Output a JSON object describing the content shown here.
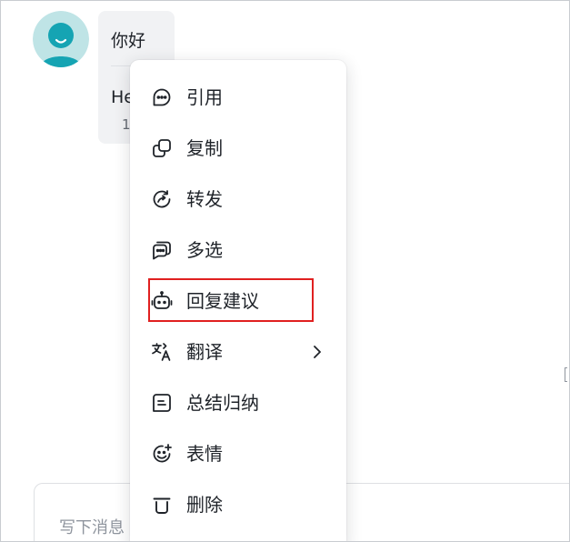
{
  "message": {
    "text": "你好",
    "translation_prefix": "He",
    "meta_prefix": "1"
  },
  "composer": {
    "placeholder": "写下消息"
  },
  "menu": {
    "items": [
      {
        "label": "引用",
        "icon": "quote-icon"
      },
      {
        "label": "复制",
        "icon": "copy-icon"
      },
      {
        "label": "转发",
        "icon": "forward-icon"
      },
      {
        "label": "多选",
        "icon": "multi-select-icon"
      },
      {
        "label": "回复建议",
        "icon": "robot-icon",
        "highlighted": true
      },
      {
        "label": "翻译",
        "icon": "translate-icon",
        "has_submenu": true
      },
      {
        "label": "总结归纳",
        "icon": "summary-icon"
      },
      {
        "label": "表情",
        "icon": "emoji-add-icon"
      },
      {
        "label": "删除",
        "icon": "trash-icon"
      }
    ]
  },
  "colors": {
    "avatar_bg": "#bfe4e6",
    "avatar_fg": "#15a4b3",
    "highlight_border": "#e02020",
    "bubble_bg": "#f1f2f4"
  }
}
